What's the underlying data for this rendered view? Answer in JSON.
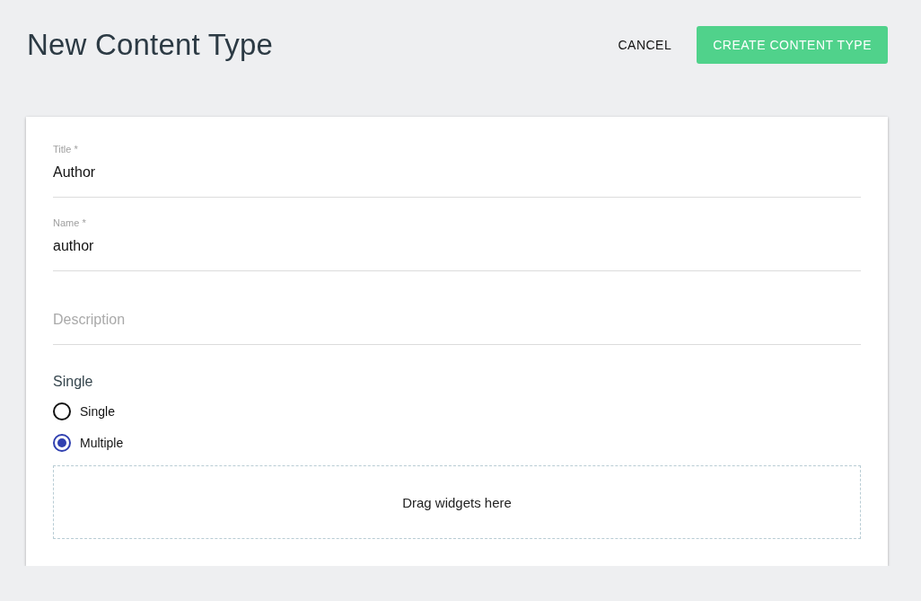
{
  "header": {
    "title": "New Content Type",
    "cancel_button": "CANCEL",
    "create_button": "CREATE CONTENT TYPE"
  },
  "fields": [
    {
      "label": "Title *",
      "value": "Author"
    },
    {
      "label": "Name *",
      "value": "author"
    },
    {
      "placeholder": "Description"
    }
  ],
  "radio_group": {
    "label": "Single",
    "options": [
      {
        "label": "Single",
        "selected": false
      },
      {
        "label": "Multiple",
        "selected": true
      }
    ]
  },
  "drop_zone": {
    "text": "Drag widgets here"
  }
}
